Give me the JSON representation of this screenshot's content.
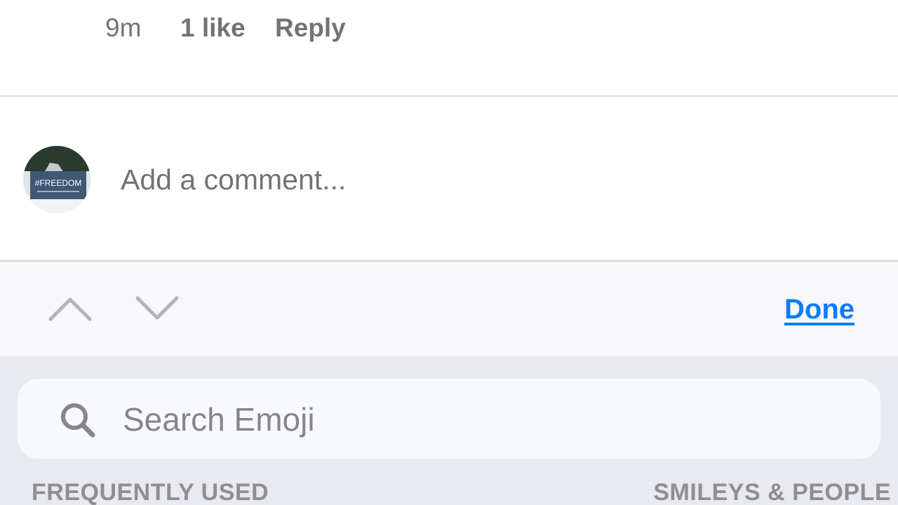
{
  "comment": {
    "time": "9m",
    "likes": "1 like",
    "reply_label": "Reply"
  },
  "composer": {
    "placeholder": "Add a comment...",
    "avatar_text": "#FREEDOM"
  },
  "accessory": {
    "up_icon": "chevron-up-icon",
    "down_icon": "chevron-down-icon",
    "done_label": "Done"
  },
  "emoji_keyboard": {
    "search_placeholder": "Search Emoji",
    "search_icon": "search-icon",
    "categories": [
      "FREQUENTLY USED",
      "SMILEYS & PEOPLE"
    ]
  },
  "colors": {
    "accent": "#0a7cff",
    "secondary_text": "#737373",
    "keyboard_bg": "#e9eaef"
  }
}
